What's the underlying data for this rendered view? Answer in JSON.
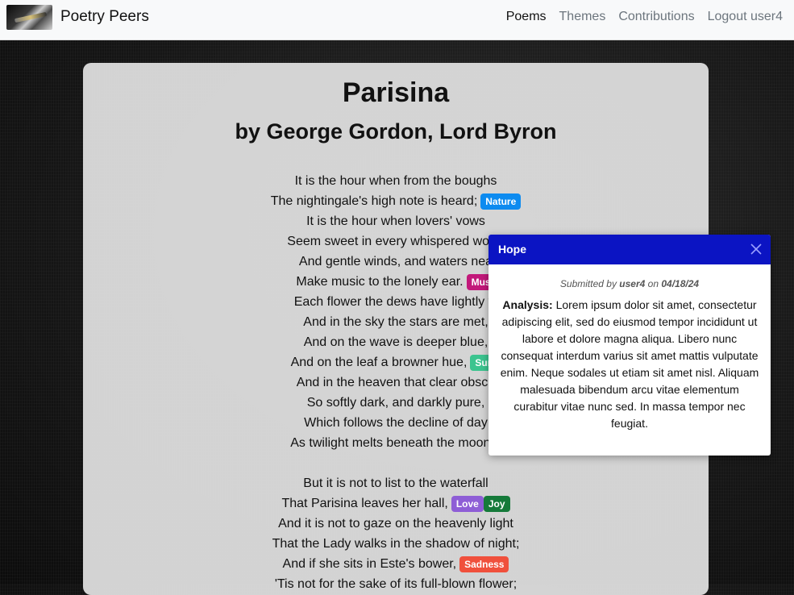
{
  "navbar": {
    "brand": "Poetry Peers",
    "links": [
      "Poems",
      "Themes",
      "Contributions",
      "Logout user4"
    ]
  },
  "poem": {
    "title": "Parisina",
    "author": "by George Gordon, Lord Byron",
    "lines": [
      "It is the hour when from the boughs",
      "The nightingale's high note is heard;",
      "It is the hour when lovers' vows",
      "Seem sweet in every whispered word;",
      "And gentle winds, and waters nea",
      "Make music to the lonely ear.",
      "Each flower the dews have lightly w",
      "And in the sky the stars are met,",
      "And on the wave is deeper blue,",
      "And on the leaf a browner hue,",
      "And in the heaven that clear obscu",
      "So softly dark, and darkly pure,",
      "Which follows the decline of day",
      "As twilight melts beneath the moon a",
      "",
      "But it is not to list to the waterfall",
      "That Parisina leaves her hall,",
      "And it is not to gaze on the heavenly light",
      "That the Lady walks in the shadow of night;",
      "And if she sits in Este's bower,",
      "'Tis not for the sake of its full-blown flower;"
    ],
    "tags": {
      "nature": {
        "label": "Nature",
        "color": "#0d8bf0"
      },
      "music": {
        "label": "Mus",
        "color": "#c2187a"
      },
      "summer": {
        "label": "Sum",
        "color": "#3cc48f"
      },
      "love": {
        "label": "Love",
        "color": "#8e5ed6"
      },
      "joy": {
        "label": "Joy",
        "color": "#157a3a"
      },
      "sadness": {
        "label": "Sadness",
        "color": "#f0503c"
      }
    }
  },
  "popover": {
    "title": "Hope",
    "submitted_prefix": "Submitted by",
    "user": "user4",
    "on": "on",
    "date": "04/18/24",
    "analysis_label": "Analysis:",
    "analysis_text": "Lorem ipsum dolor sit amet, consectetur adipiscing elit, sed do eiusmod tempor incididunt ut labore et dolore magna aliqua. Libero nunc consequat interdum varius sit amet mattis vulputate enim. Neque sodales ut etiam sit amet nisl. Aliquam malesuada bibendum arcu vitae elementum curabitur vitae nunc sed. In massa tempor nec feugiat.",
    "header_color": "#0b14c3"
  }
}
